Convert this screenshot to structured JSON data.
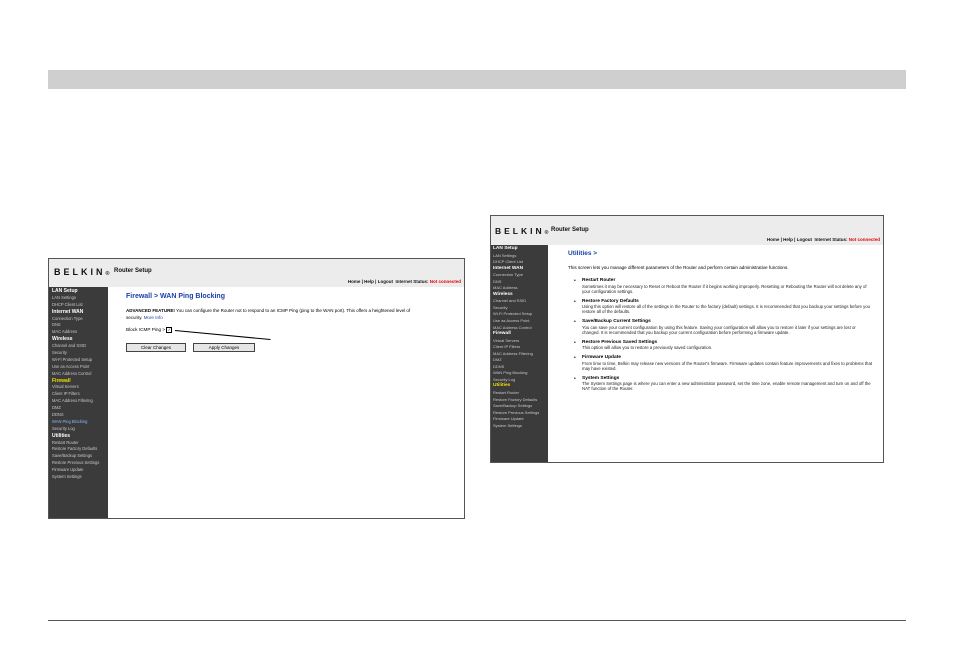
{
  "left_shot": {
    "logo": "BELKIN",
    "logo_mark": "®",
    "app_title": "Router Setup",
    "status_links": "Home | Help | Logout",
    "status_label": "Internet Status:",
    "status_value": "Not connected",
    "nav": [
      {
        "label": "LAN Setup",
        "kind": "sec"
      },
      {
        "label": "LAN Settings",
        "kind": "item"
      },
      {
        "label": "DHCP Client List",
        "kind": "item"
      },
      {
        "label": "Internet WAN",
        "kind": "sec"
      },
      {
        "label": "Connection Type",
        "kind": "item"
      },
      {
        "label": "DNS",
        "kind": "item"
      },
      {
        "label": "MAC Address",
        "kind": "item"
      },
      {
        "label": "Wireless",
        "kind": "sec"
      },
      {
        "label": "Channel and SSID",
        "kind": "item"
      },
      {
        "label": "Security",
        "kind": "item"
      },
      {
        "label": "Wi-Fi Protected Setup",
        "kind": "item"
      },
      {
        "label": "Use as Access Point",
        "kind": "item"
      },
      {
        "label": "MAC Address Control",
        "kind": "item"
      },
      {
        "label": "Firewall",
        "kind": "sec-hl"
      },
      {
        "label": "Virtual Servers",
        "kind": "item"
      },
      {
        "label": "Client IP Filters",
        "kind": "item"
      },
      {
        "label": "MAC Address Filtering",
        "kind": "item"
      },
      {
        "label": "DMZ",
        "kind": "item"
      },
      {
        "label": "DDNS",
        "kind": "item"
      },
      {
        "label": "WAN Ping Blocking",
        "kind": "cur"
      },
      {
        "label": "Security Log",
        "kind": "item"
      },
      {
        "label": "Utilities",
        "kind": "sec"
      },
      {
        "label": "Restart Router",
        "kind": "item"
      },
      {
        "label": "Restore Factory Defaults",
        "kind": "item"
      },
      {
        "label": "Save/Backup Settings",
        "kind": "item"
      },
      {
        "label": "Restore Previous Settings",
        "kind": "item"
      },
      {
        "label": "Firmware Update",
        "kind": "item"
      },
      {
        "label": "System Settings",
        "kind": "item"
      }
    ],
    "page_title": "Firewall > WAN Ping Blocking",
    "adv_label": "ADVANCED FEATURE!",
    "adv_text": "You can configure the Router not to respond to an ICMP Ping (ping to the WAN port). This offers a heightened level of security.",
    "more_info": "More Info",
    "icmp_label": "Block ICMP Ping >",
    "icmp_checked": "✓",
    "clear_button": "Clear Changes",
    "apply_button": "Apply Changes"
  },
  "right_shot": {
    "logo": "BELKIN",
    "logo_mark": "®",
    "app_title": "Router Setup",
    "status_links": "Home | Help | Logout",
    "status_label": "Internet Status:",
    "status_value": "Not connected",
    "nav": [
      {
        "label": "LAN Setup",
        "kind": "sec"
      },
      {
        "label": "LAN Settings",
        "kind": "item"
      },
      {
        "label": "DHCP Client List",
        "kind": "item"
      },
      {
        "label": "Internet WAN",
        "kind": "sec"
      },
      {
        "label": "Connection Type",
        "kind": "item"
      },
      {
        "label": "DNS",
        "kind": "item"
      },
      {
        "label": "MAC Address",
        "kind": "item"
      },
      {
        "label": "Wireless",
        "kind": "sec"
      },
      {
        "label": "Channel and SSID",
        "kind": "item"
      },
      {
        "label": "Security",
        "kind": "item"
      },
      {
        "label": "Wi-Fi Protected Setup",
        "kind": "item"
      },
      {
        "label": "Use as Access Point",
        "kind": "item"
      },
      {
        "label": "MAC Address Control",
        "kind": "item"
      },
      {
        "label": "Firewall",
        "kind": "sec"
      },
      {
        "label": "Virtual Servers",
        "kind": "item"
      },
      {
        "label": "Client IP Filters",
        "kind": "item"
      },
      {
        "label": "MAC Address Filtering",
        "kind": "item"
      },
      {
        "label": "DMZ",
        "kind": "item"
      },
      {
        "label": "DDNS",
        "kind": "item"
      },
      {
        "label": "WAN Ping Blocking",
        "kind": "item"
      },
      {
        "label": "Security Log",
        "kind": "item"
      },
      {
        "label": "Utilities",
        "kind": "sec-hl"
      },
      {
        "label": "Restart Router",
        "kind": "item"
      },
      {
        "label": "Restore Factory Defaults",
        "kind": "item"
      },
      {
        "label": "Save/Backup Settings",
        "kind": "item"
      },
      {
        "label": "Restore Previous Settings",
        "kind": "item"
      },
      {
        "label": "Firmware Update",
        "kind": "item"
      },
      {
        "label": "System Settings",
        "kind": "item"
      }
    ],
    "page_title": "Utilities >",
    "intro": "This screen lets you manage different parameters of the Router and perform certain administrative functions.",
    "items": [
      {
        "title": "Restart Router",
        "body": "Sometimes it may be necessary to Reset or Reboot the Router if it begins working improperly. Resetting or Rebooting the Router will not delete any of your configuration settings."
      },
      {
        "title": "Restore Factory Defaults",
        "body": "Using this option will restore all of the settings in the Router to the factory (default) settings. It is recommended that you backup your settings before you restore all of the defaults."
      },
      {
        "title": "Save/Backup Current Settings",
        "body": "You can save your current configuration by using this feature. Saving your configuration will allow you to restore it later if your settings are lost or changed. It is recommended that you backup your current configuration before performing a firmware update."
      },
      {
        "title": "Restore Previous Saved Settings",
        "body": "This option will allow you to restore a previously saved configuration."
      },
      {
        "title": "Firmware Update",
        "body": "From time to time, Belkin may release new versions of the Router's firmware. Firmware updates contain feature improvements and fixes to problems that may have existed."
      },
      {
        "title": "System Settings",
        "body": "The System Settings page is where you can enter a new administrator password, set the time zone, enable remote management and turn on and off the NAT function of the Router."
      }
    ]
  }
}
